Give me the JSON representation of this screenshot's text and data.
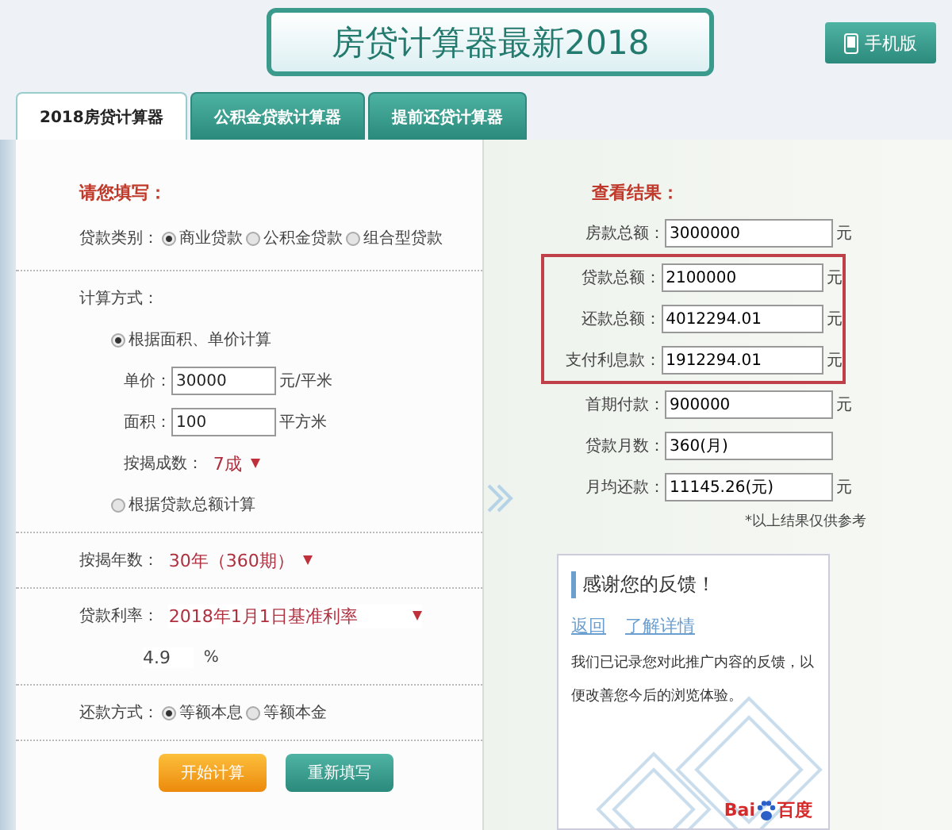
{
  "header": {
    "title": "房贷计算器最新2018",
    "mobile_button": "手机版"
  },
  "tabs": [
    {
      "label": "2018房贷计算器",
      "selected": true
    },
    {
      "label": "公积金贷款计算器",
      "selected": false
    },
    {
      "label": "提前还贷计算器",
      "selected": false
    }
  ],
  "form": {
    "heading": "请您填写：",
    "loan_type": {
      "label": "贷款类别：",
      "options": [
        {
          "label": "商业贷款",
          "selected": true
        },
        {
          "label": "公积金贷款",
          "selected": false
        },
        {
          "label": "组合型贷款",
          "selected": false
        }
      ]
    },
    "calc_method": {
      "label": "计算方式：",
      "options": [
        {
          "label": "根据面积、单价计算",
          "selected": true,
          "fields": [
            {
              "label": "单价：",
              "value": "30000",
              "unit": "元/平米"
            },
            {
              "label": "面积：",
              "value": "100",
              "unit": "平方米"
            }
          ],
          "ratio": {
            "label": "按揭成数：",
            "value": "7成"
          }
        },
        {
          "label": "根据贷款总额计算",
          "selected": false
        }
      ]
    },
    "years": {
      "label": "按揭年数：",
      "value": "30年（360期）"
    },
    "rate": {
      "label": "贷款利率：",
      "value": "2018年1月1日基准利率",
      "rate_value": "4.9",
      "unit": "%"
    },
    "repayment": {
      "label": "还款方式：",
      "options": [
        {
          "label": "等额本息",
          "selected": true
        },
        {
          "label": "等额本金",
          "selected": false
        }
      ]
    },
    "buttons": [
      {
        "label": "开始计算",
        "kind": "primary"
      },
      {
        "label": "重新填写",
        "kind": "secondary"
      }
    ]
  },
  "results": {
    "heading": "查看结果：",
    "rows": [
      {
        "label": "房款总额：",
        "value": "3000000",
        "unit": "元",
        "highlighted": false
      },
      {
        "label": "贷款总额：",
        "value": "2100000",
        "unit": "元",
        "highlighted": true
      },
      {
        "label": "还款总额：",
        "value": "4012294.01",
        "unit": "元",
        "highlighted": true
      },
      {
        "label": "支付利息款：",
        "value": "1912294.01",
        "unit": "元",
        "highlighted": true
      },
      {
        "label": "首期付款：",
        "value": "900000",
        "unit": "元",
        "highlighted": false
      },
      {
        "label": "贷款月数：",
        "value": "360(月)",
        "highlighted": false
      },
      {
        "label": "月均还款：",
        "value": "11145.26(元)",
        "unit": "元",
        "highlighted": false
      }
    ],
    "note": "*以上结果仅供参考"
  },
  "feedback_card": {
    "title": "感谢您的反馈！",
    "links": [
      "返回",
      "了解详情"
    ],
    "message": "我们已记录您对此推广内容的反馈，以便改善您今后的浏览体验。",
    "logo": {
      "latin": "Bai",
      "chinese": "百度"
    }
  }
}
